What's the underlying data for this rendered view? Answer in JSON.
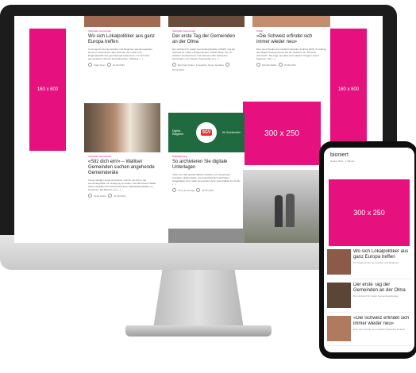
{
  "ads": {
    "left_tall": "160 x 600",
    "right_tall": "160 x 600",
    "square": "300 x 250"
  },
  "cards": {
    "c1": {
      "category": "Verbände Gemeinden",
      "title": "Wo sich Lokalpolitiker aus ganz Europa treffen",
      "text": "Im Kongress der Gemeinden und Regionen des Europarates kommen zweimal pro Jahr Vertreter der Lokal- und Regionalpolitik aus ganz Europa zusammen, um sich über gemeinsame Themen auszutauschen. Christine (...)",
      "author": "Katja Suter",
      "date": "10.06.2024"
    },
    "c2": {
      "category": "Verbände Gemeinden",
      "title": "Der erste Tag der Gemeinden an der Olma",
      "text": "Der Verband St. Galler Gemeindepräsidien (VSGP) und der Verband St. Galler Ortsgemeinden (VSGP) laden am 16. Oktober Vertreterinnen und Vertreter aller Schweizer Gemeinden zum Tag der Gemeinden an (...)",
      "author": "Bernhard Keller",
      "author_extra": "Fotografin: Nemo Gentiste",
      "date": "05.09.2024"
    },
    "c3": {
      "category": "Politik",
      "title": "«Die Schweiz erfindet sich immer wieder neu»",
      "text": "Eine neue Studie des Gottlieb Duttweiler Instituts (GDI) im Auftrag des Migros-Kulturprozents hat die Vielfalt in der Schweiz untersucht. Sie zeigt, auf dass sich manche Gruppen bereit beginnen. Sie (...)",
      "author": "Monika Müller",
      "date": "05.09.2024"
    },
    "c4": {
      "category": "Verbände Gemeinden",
      "title": "«Sitz dich ein!» – Walliser Gemeinden suchen angehende Gemeinderäte",
      "text": "Immer weniger Leute sind bereit, sich für ein Amt in der Gemeindepolitik zur Verfügung zu stellen. Gemäß Kanton Wallis haben deshalb sich Schweizweit Eine Stadtratskandidaten zu bewerben. Ein Besuch von (...)",
      "author": "Tanja Sutter",
      "date": "01.08.2024"
    },
    "c5": {
      "banner_left": "Digital-Ratgeber",
      "banner_badge": "SGV",
      "banner_right": "für Gemeinden",
      "category": "Digitalisierung",
      "title": "So archivieren Sie digitale Unterlagen",
      "text": "«Wer zum Teil pfarrkundlichen Archive von Gemeinden enthalten elektronische, die ausschliesslich auf Papier festgehalten sind. Viele Gemeinden zieht zwar digitale ins Archiv (...)",
      "author": "Timo Sommaga",
      "date": "05.09.2024"
    }
  },
  "phone": {
    "top_title": "bioniert",
    "top_meta": "Nadine Böni",
    "top_date": "1 Minute",
    "ad": "300 x 250",
    "items": [
      {
        "title": "Wo sich Lokalpolitiker aus ganz Europa treffen",
        "meta": "Im Kongress der Gemeinden und Regionen"
      },
      {
        "title": "Der erste Tag der Gemeinden an der Olma",
        "meta": "Der Verband St. Galler Gemeindepräsidien"
      },
      {
        "title": "«Die Schweiz erfindet sich immer wieder neu»",
        "meta": "Eine neue Studie des Gottlieb Duttweiler Instituts"
      }
    ]
  }
}
